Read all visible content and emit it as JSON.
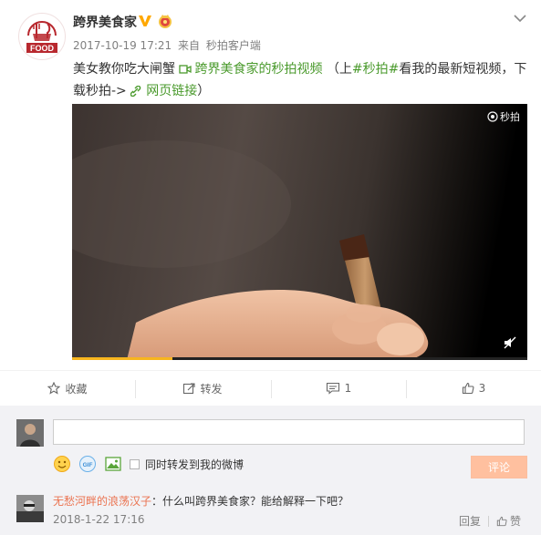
{
  "post": {
    "author": "跨界美食家",
    "avatar_label": "FOOD",
    "timestamp": "2017-10-19 17:21",
    "from_word": "来自",
    "source": "秒拍客户端",
    "text_line1_pre": "美女教你吃大闸蟹 ",
    "video_link": "跨界美食家的秒拍视频",
    "text_paren_open": " （上",
    "hashtag": "#秒拍#",
    "text_after_hashtag": "看我的最新短视频，下",
    "text_line2": "载秒拍->",
    "web_link": "网页链接",
    "text_paren_close": "）"
  },
  "video": {
    "watermark": "秒拍",
    "progress": 0.22
  },
  "actions": {
    "favorite_label": "收藏",
    "repost_label": "转发",
    "comment_count": "1",
    "like_count": "3"
  },
  "composer": {
    "input_value": "",
    "also_repost_label": "同时转发到我的微博",
    "submit_label": "评论"
  },
  "comment": {
    "user": "无愁河畔的浪荡汉子",
    "colon": "：",
    "text": "什么叫跨界美食家？能给解释一下吧？",
    "time": "2018-1-22 17:16",
    "reply_label": "回复",
    "like_label": "赞"
  },
  "colors": {
    "link_green": "#4a9a2c",
    "username_orange": "#eb7350",
    "progress_yellow": "#f7b51e",
    "submit_disabled": "#ffc09f",
    "panel_bg": "#f2f2f5"
  }
}
